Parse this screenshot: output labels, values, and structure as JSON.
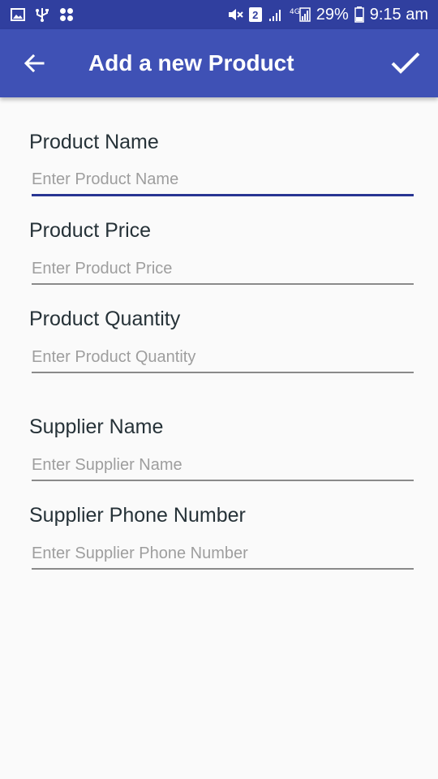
{
  "status_bar": {
    "battery_percent": "29%",
    "time": "9:15 am",
    "sim_badge": "2",
    "network_type": "4G",
    "icons_left": [
      "image-icon",
      "usb-icon",
      "apps-icon"
    ],
    "icons_right": [
      "mute-icon",
      "sim-badge",
      "signal-icon",
      "signal-4g-icon",
      "battery-icon"
    ]
  },
  "app_bar": {
    "title": "Add a new Product",
    "back_icon": "arrow-back-icon",
    "save_icon": "check-icon",
    "color": "#3f51b5",
    "status_color": "#303f9f"
  },
  "form": {
    "product_name": {
      "label": "Product Name",
      "placeholder": "Enter Product Name",
      "value": ""
    },
    "product_price": {
      "label": "Product Price",
      "placeholder": "Enter Product Price",
      "value": ""
    },
    "product_quantity": {
      "label": "Product Quantity",
      "placeholder": "Enter Product Quantity",
      "value": ""
    },
    "supplier_name": {
      "label": "Supplier Name",
      "placeholder": "Enter Supplier Name",
      "value": ""
    },
    "supplier_phone": {
      "label": "Supplier Phone Number",
      "placeholder": "Enter Supplier Phone Number",
      "value": ""
    }
  }
}
